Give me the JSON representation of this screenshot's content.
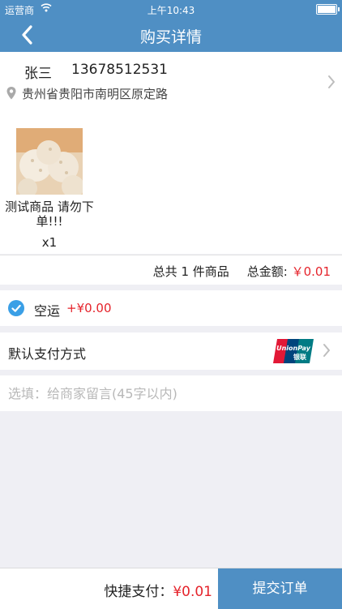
{
  "status_bar": {
    "carrier": "运营商",
    "time": "上午10:43"
  },
  "nav": {
    "title": "购买详情",
    "back_icon": "chevron-left-icon"
  },
  "address": {
    "name": "张三",
    "phone": "13678512531",
    "location": "贵州省贵阳市南明区原定路"
  },
  "product": {
    "name": "测试商品 请勿下单!!!",
    "quantity": "x1"
  },
  "summary": {
    "total_items": "总共 1 件商品",
    "total_label": "总金额: ",
    "total_amount": "￥0.01"
  },
  "shipping": {
    "method": "空运",
    "price": "+¥0.00",
    "checked": true
  },
  "payment": {
    "label": "默认支付方式",
    "logo_text": "UnionPay",
    "logo_text_cn": "银联"
  },
  "message": {
    "placeholder": "选填：给商家留言(45字以内)",
    "value": ""
  },
  "footer": {
    "quick_pay_label": "快捷支付：",
    "quick_pay_amount": "¥0.01",
    "submit_label": "提交订单"
  },
  "colors": {
    "primary": "#4f8fc4",
    "price_red": "#e5232b",
    "background": "#efeff4"
  }
}
